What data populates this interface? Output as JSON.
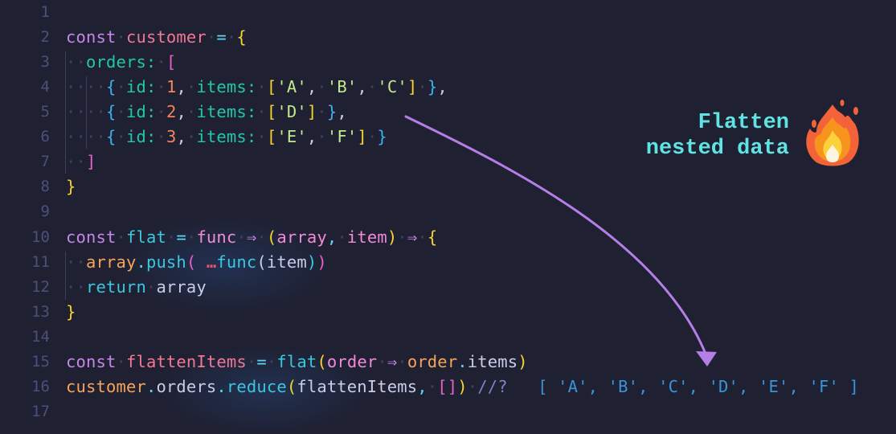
{
  "editor": {
    "line_numbers": [
      "1",
      "2",
      "3",
      "4",
      "5",
      "6",
      "7",
      "8",
      "9",
      "10",
      "11",
      "12",
      "13",
      "14",
      "15",
      "16",
      "17"
    ],
    "lines": {
      "l2": {
        "kw": "const",
        "name": "customer",
        "eq": "=",
        "open": "{"
      },
      "l3": {
        "prop": "orders:",
        "open": "["
      },
      "l4": {
        "open": "{",
        "id_key": "id:",
        "id_val": "1",
        "comma": ",",
        "items_key": "items:",
        "arr_open": "[",
        "vals": [
          "'A'",
          "'B'",
          "'C'"
        ],
        "arr_close": "]",
        "close": "}",
        "tail": ","
      },
      "l5": {
        "open": "{",
        "id_key": "id:",
        "id_val": "2",
        "comma": ",",
        "items_key": "items:",
        "arr_open": "[",
        "vals": [
          "'D'"
        ],
        "arr_close": "]",
        "close": "}",
        "tail": ","
      },
      "l6": {
        "open": "{",
        "id_key": "id:",
        "id_val": "3",
        "comma": ",",
        "items_key": "items:",
        "arr_open": "[",
        "vals": [
          "'E'",
          "'F'"
        ],
        "arr_close": "]",
        "close": "}"
      },
      "l7": {
        "close": "]"
      },
      "l8": {
        "close": "}"
      },
      "l10": {
        "kw": "const",
        "name": "flat",
        "eq": "=",
        "param": "func",
        "arrow1": "⇒",
        "p_open": "(",
        "arg1": "array",
        "comma": ",",
        "arg2": "item",
        "p_close": ")",
        "arrow2": "⇒",
        "open": "{"
      },
      "l11": {
        "obj": "array",
        "dot": ".",
        "method": "push",
        "p_open": "(",
        "spread": "…",
        "call": "func",
        "c_open": "(",
        "arg": "item",
        "c_close": ")",
        "p_close": ")"
      },
      "l12": {
        "kw": "return",
        "val": "array"
      },
      "l13": {
        "close": "}"
      },
      "l15": {
        "kw": "const",
        "name": "flattenItems",
        "eq": "=",
        "call": "flat",
        "p_open": "(",
        "arg": "order",
        "arrow": "⇒",
        "obj": "order",
        "dot": ".",
        "prop": "items",
        "p_close": ")"
      },
      "l16": {
        "obj": "customer",
        "dot1": ".",
        "prop": "orders",
        "dot2": ".",
        "method": "reduce",
        "p_open": "(",
        "arg": "flattenItems",
        "comma": ",",
        "arr": "[]",
        "p_close": ")",
        "comment": "//?",
        "result": "[ 'A', 'B', 'C', 'D', 'E', 'F' ]"
      }
    }
  },
  "callout": {
    "line1": "Flatten",
    "line2": "nested data",
    "icon": "fire-emoji",
    "arrow_color": "#b57ee6",
    "text_color": "#5fe3e3"
  },
  "theme": {
    "background": "#1f2133",
    "line_number_color": "#4a5078"
  }
}
